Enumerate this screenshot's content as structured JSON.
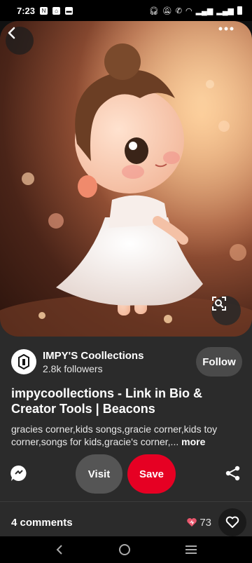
{
  "status_bar": {
    "time": "7:23",
    "left_icons": [
      "notification-n-icon",
      "home-icon",
      "message-icon"
    ],
    "right_icons": [
      "headset-icon",
      "mute-icon",
      "wifi-call-icon",
      "wifi-icon",
      "signal-icon",
      "signal-icon",
      "battery-icon"
    ]
  },
  "creator": {
    "name": "IMPY'S Coollections",
    "followers": "2.8k followers",
    "follow_label": "Follow"
  },
  "pin": {
    "title": "impycoollections - Link in Bio & Creator Tools | Beacons",
    "description": "gracies corner,kids songs,gracie corner,kids toy corner,songs for kids,gracie's corner,...",
    "more_label": "more"
  },
  "actions": {
    "visit_label": "Visit",
    "save_label": "Save"
  },
  "comments": {
    "label": "4 comments",
    "reaction_count": "73"
  },
  "colors": {
    "save_red": "#e60023",
    "background": "#2b2b2b",
    "reaction_pink": "#e8566c"
  }
}
